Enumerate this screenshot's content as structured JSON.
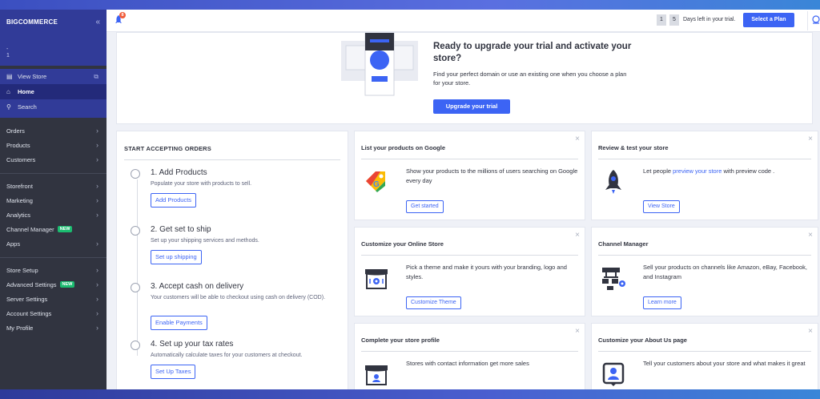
{
  "sidebar": {
    "brand": "BIGCOMMERCE",
    "store_lines": [
      "-",
      "1"
    ],
    "view_store": "View Store",
    "home": "Home",
    "search": "Search",
    "group1": [
      "Orders",
      "Products",
      "Customers"
    ],
    "group2": [
      "Storefront",
      "Marketing",
      "Analytics",
      "Channel Manager",
      "Apps"
    ],
    "group3": [
      "Store Setup",
      "Advanced Settings",
      "Server Settings",
      "Account Settings",
      "My Profile"
    ],
    "new_badge": "NEW"
  },
  "topbar": {
    "notification_count": "8",
    "day_digit_1": "1",
    "day_digit_2": "5",
    "days_left_text": "Days left in your trial.",
    "select_plan": "Select a Plan"
  },
  "banner": {
    "title": "Ready to upgrade your trial and activate your store?",
    "text": "Find your perfect domain or use an existing one when you choose a plan for your store.",
    "button": "Upgrade your trial"
  },
  "orders": {
    "title": "START ACCEPTING ORDERS",
    "steps": [
      {
        "title": "1. Add Products",
        "desc": "Populate your store with products to sell.",
        "button": "Add Products"
      },
      {
        "title": "2. Get set to ship",
        "desc": "Set up your shipping services and methods.",
        "button": "Set up shipping"
      },
      {
        "title": "3. Accept cash on delivery",
        "desc": "Your customers will be able to checkout using cash on delivery (COD).",
        "button": "Enable Payments"
      },
      {
        "title": "4. Set up your tax rates",
        "desc": "Automatically calculate taxes for your customers at checkout.",
        "button": "Set Up Taxes"
      }
    ]
  },
  "cards": {
    "google": {
      "title": "List your products on Google",
      "text": "Show your products to the millions of users searching on Google every day",
      "button": "Get started"
    },
    "review": {
      "title": "Review & test your store",
      "text_before": "Let people ",
      "link": "preview your store",
      "text_after": " with preview code .",
      "button": "View Store"
    },
    "customize": {
      "title": "Customize your Online Store",
      "text": "Pick a theme and make it yours with your branding, logo and styles.",
      "button": "Customize Theme"
    },
    "channel": {
      "title": "Channel Manager",
      "text": "Sell your products on channels like Amazon, eBay, Facebook, and Instagram",
      "button": "Learn more"
    },
    "profile": {
      "title": "Complete your store profile",
      "text": "Stores with contact information get more sales"
    },
    "about": {
      "title": "Customize your About Us page",
      "text": "Tell your customers about your store and what makes it great"
    }
  },
  "icons": {
    "close": "×",
    "chevron": "›",
    "collapse": "«"
  },
  "colors": {
    "accent": "#3c64f4",
    "sidebar": "#313440",
    "sidebar_brand": "#313b98",
    "new_badge": "#1bbc70"
  }
}
